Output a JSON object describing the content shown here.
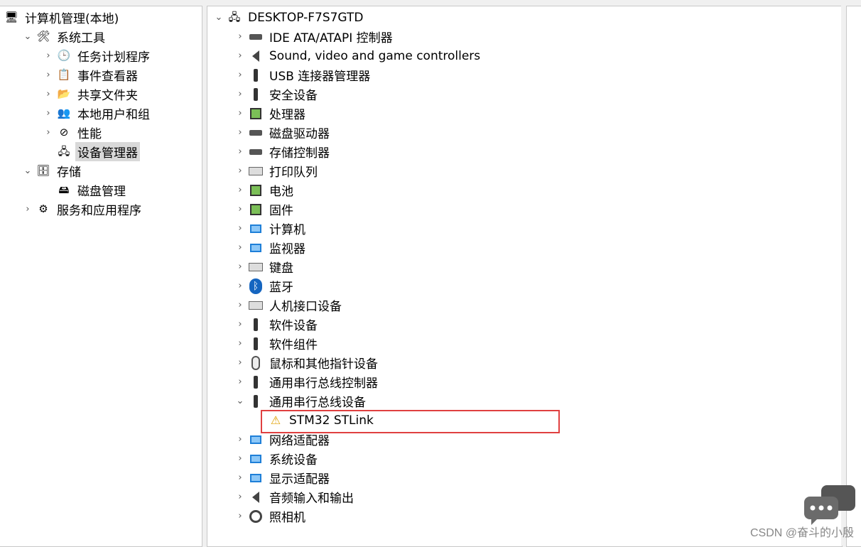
{
  "left_tree": [
    {
      "label": "计算机管理(本地)",
      "icon": "computer-management-icon",
      "glyph": "🖥",
      "indent": 0,
      "chevron": ""
    },
    {
      "label": "系统工具",
      "icon": "system-tools-icon",
      "glyph": "🛠",
      "indent": 1,
      "chevron": "⌄"
    },
    {
      "label": "任务计划程序",
      "icon": "task-scheduler-icon",
      "glyph": "🕒",
      "indent": 2,
      "chevron": "›"
    },
    {
      "label": "事件查看器",
      "icon": "event-viewer-icon",
      "glyph": "📋",
      "indent": 2,
      "chevron": "›"
    },
    {
      "label": "共享文件夹",
      "icon": "shared-folders-icon",
      "glyph": "📂",
      "indent": 2,
      "chevron": "›"
    },
    {
      "label": "本地用户和组",
      "icon": "local-users-icon",
      "glyph": "👥",
      "indent": 2,
      "chevron": "›"
    },
    {
      "label": "性能",
      "icon": "performance-icon",
      "glyph": "⊘",
      "indent": 2,
      "chevron": "›"
    },
    {
      "label": "设备管理器",
      "icon": "device-manager-icon",
      "glyph": "🖧",
      "indent": 2,
      "chevron": "",
      "selected": true
    },
    {
      "label": "存储",
      "icon": "storage-icon",
      "glyph": "🗄",
      "indent": 1,
      "chevron": "⌄"
    },
    {
      "label": "磁盘管理",
      "icon": "disk-management-icon",
      "glyph": "🖴",
      "indent": 2,
      "chevron": ""
    },
    {
      "label": "服务和应用程序",
      "icon": "services-apps-icon",
      "glyph": "⚙",
      "indent": 1,
      "chevron": "›"
    }
  ],
  "device_tree": {
    "root": {
      "label": "DESKTOP-F7S7GTD",
      "icon": "computer-root-icon"
    },
    "items": [
      {
        "label": "IDE ATA/ATAPI 控制器",
        "icon": "ide-controller-icon",
        "cls": "ic-disk",
        "chevron": "›"
      },
      {
        "label": "Sound, video and game controllers",
        "icon": "speaker-icon",
        "cls": "ic-speaker",
        "chevron": "›"
      },
      {
        "label": "USB 连接器管理器",
        "icon": "usb-connector-icon",
        "cls": "ic-usb",
        "chevron": "›"
      },
      {
        "label": "安全设备",
        "icon": "security-device-icon",
        "cls": "ic-usb",
        "chevron": "›"
      },
      {
        "label": "处理器",
        "icon": "processor-icon",
        "cls": "ic-chip",
        "chevron": "›"
      },
      {
        "label": "磁盘驱动器",
        "icon": "disk-drive-icon",
        "cls": "ic-disk",
        "chevron": "›"
      },
      {
        "label": "存储控制器",
        "icon": "storage-controller-icon",
        "cls": "ic-disk",
        "chevron": "›"
      },
      {
        "label": "打印队列",
        "icon": "printer-icon",
        "cls": "ic-kbd",
        "chevron": "›"
      },
      {
        "label": "电池",
        "icon": "battery-icon",
        "cls": "ic-chip",
        "chevron": "›"
      },
      {
        "label": "固件",
        "icon": "firmware-icon",
        "cls": "ic-chip",
        "chevron": "›"
      },
      {
        "label": "计算机",
        "icon": "computer-icon",
        "cls": "ic-monitor",
        "chevron": "›"
      },
      {
        "label": "监视器",
        "icon": "monitor-icon",
        "cls": "ic-monitor",
        "chevron": "›"
      },
      {
        "label": "键盘",
        "icon": "keyboard-icon",
        "cls": "ic-kbd",
        "chevron": "›"
      },
      {
        "label": "蓝牙",
        "icon": "bluetooth-icon",
        "cls": "ic-bt",
        "glyph": "ᛒ",
        "chevron": "›"
      },
      {
        "label": "人机接口设备",
        "icon": "hid-icon",
        "cls": "ic-kbd",
        "chevron": "›"
      },
      {
        "label": "软件设备",
        "icon": "software-device-icon",
        "cls": "ic-usb",
        "chevron": "›"
      },
      {
        "label": "软件组件",
        "icon": "software-component-icon",
        "cls": "ic-usb",
        "chevron": "›"
      },
      {
        "label": "鼠标和其他指针设备",
        "icon": "mouse-icon",
        "cls": "ic-mouse",
        "chevron": "›"
      },
      {
        "label": "通用串行总线控制器",
        "icon": "usb-controller-icon",
        "cls": "ic-usb",
        "chevron": "›"
      },
      {
        "label": "通用串行总线设备",
        "icon": "usb-device-icon",
        "cls": "ic-usb",
        "chevron": "⌄"
      },
      {
        "label": "STM32 STLink",
        "icon": "warning-icon",
        "cls": "ic-warning",
        "glyph": "⚠",
        "chevron": "",
        "child": true
      },
      {
        "label": "网络适配器",
        "icon": "network-adapter-icon",
        "cls": "ic-monitor",
        "chevron": "›"
      },
      {
        "label": "系统设备",
        "icon": "system-device-icon",
        "cls": "ic-monitor",
        "chevron": "›"
      },
      {
        "label": "显示适配器",
        "icon": "display-adapter-icon",
        "cls": "ic-monitor",
        "chevron": "›"
      },
      {
        "label": "音频输入和输出",
        "icon": "audio-io-icon",
        "cls": "ic-speaker",
        "chevron": "›"
      },
      {
        "label": "照相机",
        "icon": "camera-icon",
        "cls": "ic-cam",
        "chevron": "›"
      }
    ]
  },
  "watermark": "CSDN @奋斗的小殷"
}
